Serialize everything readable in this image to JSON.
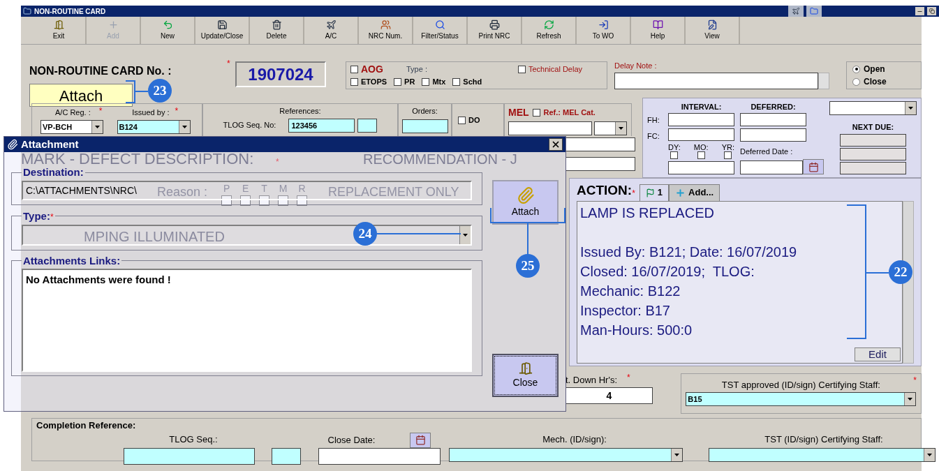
{
  "window": {
    "title": "NON-ROUTINE CARD"
  },
  "toolbar": [
    {
      "label": "Exit",
      "disabled": false
    },
    {
      "label": "Add",
      "disabled": true
    },
    {
      "label": "New",
      "disabled": false
    },
    {
      "label": "Update/Close",
      "disabled": false
    },
    {
      "label": "Delete",
      "disabled": false
    },
    {
      "label": "A/C",
      "disabled": false
    },
    {
      "label": "NRC Num.",
      "disabled": false
    },
    {
      "label": "Filter/Status",
      "disabled": false
    },
    {
      "label": "Print NRC",
      "disabled": false
    },
    {
      "label": "Refresh",
      "disabled": false
    },
    {
      "label": "To WO",
      "disabled": false
    },
    {
      "label": "Help",
      "disabled": false
    },
    {
      "label": "View",
      "disabled": false
    }
  ],
  "card_number": {
    "label": "NON-ROUTINE CARD No. :",
    "required_mark": "*",
    "value": "1907024"
  },
  "attach_shortcut": {
    "label": "Attach"
  },
  "flags": {
    "type_label": "Type :",
    "items": [
      {
        "label": "AOG",
        "checked": false,
        "kind": "alert"
      },
      {
        "label": "ETOPS",
        "checked": false,
        "kind": "plain"
      },
      {
        "label": "PR",
        "checked": false,
        "kind": "plain"
      },
      {
        "label": "Mtx",
        "checked": false,
        "kind": "plain"
      },
      {
        "label": "Schd",
        "checked": false,
        "kind": "plain"
      }
    ],
    "technical_delay": {
      "label": "Technical Delay",
      "checked": false
    }
  },
  "delay_note": {
    "label": "Delay Note :"
  },
  "status": [
    {
      "label": "Open",
      "selected": true
    },
    {
      "label": "Close",
      "selected": false
    }
  ],
  "aircraft": {
    "reg_label": "A/C Reg. :",
    "reg_required_mark": "*",
    "reg_value": "VP-BCH",
    "issued_label": "Issued by :",
    "issued_required_mark": "*",
    "issued_value": "B124"
  },
  "references": {
    "title": "References:",
    "tlog_label": "TLOG Seq. No:",
    "tlog_value": "123456"
  },
  "orders": {
    "title": "Orders:"
  },
  "do": {
    "label": "DO",
    "checked": false
  },
  "mel": {
    "title": "MEL",
    "ref_label": "Ref.: MEL Cat.",
    "ref_checked": false
  },
  "interval": {
    "interval_title": "INTERVAL:",
    "deferred_title": "DEFERRED:",
    "fh_label": "FH:",
    "fc_label": "FC:",
    "period_checks": [
      {
        "label": "DY:",
        "checked": false
      },
      {
        "label": "MO:",
        "checked": false
      },
      {
        "label": "YR:",
        "checked": false
      }
    ],
    "deferred_date_label": "Deferred Date :",
    "next_due_title": "NEXT DUE:"
  },
  "background_form": {
    "defect_title": "MARK - DEFECT DESCRIPTION:",
    "defect_required_mark": "*",
    "recommendation_title": "RECOMMENDATION - J",
    "reason_label": "Reason :",
    "reason_checks": [
      {
        "label": "P",
        "checked": false
      },
      {
        "label": "E",
        "checked": false
      },
      {
        "label": "T",
        "checked": false
      },
      {
        "label": "M",
        "checked": false
      },
      {
        "label": "R",
        "checked": false
      }
    ],
    "defect_text": "MPING ILLUMINATED",
    "recommendation_text": "REPLACEMENT ONLY"
  },
  "action": {
    "title": "ACTION:",
    "required_mark": "*",
    "tabs": [
      {
        "label": "1",
        "selected": true
      },
      {
        "label": "Add...",
        "selected": false
      }
    ],
    "paragraphs": [
      [
        "LAMP IS REPLACED"
      ],
      [
        "Issued By: B121; Date: 16/07/2019",
        "Closed: 16/07/2019;  TLOG:",
        "Mechanic: B122",
        "Inspector: B17",
        "Man-Hours: 500:0"
      ]
    ],
    "edit_button": "Edit"
  },
  "down_hours": {
    "label": "t. Down Hr's:",
    "required_mark": "*",
    "value": "4"
  },
  "tst_approved": {
    "label": "TST approved (ID/sign) Certifying Staff:",
    "required_mark": "*",
    "value": "B15"
  },
  "completion": {
    "title": "Completion Reference:",
    "tlog_label": "TLOG Seq.:",
    "close_date_label": "Close Date:",
    "mech_label": "Mech. (ID/sign):",
    "tst_label": "TST (ID/sign) Certifying Staff:"
  },
  "attachment_dialog": {
    "title": "Attachment",
    "destination_label": "Destination:",
    "destination_value": "C:\\ATTACHMENTS\\NRC\\",
    "type_label": "Type:",
    "type_required_mark": "*",
    "links_label": "Attachments Links:",
    "links_message": "No Attachments were found !",
    "attach_button": "Attach",
    "close_button": "Close"
  },
  "callouts": [
    {
      "number": "23"
    },
    {
      "number": "24"
    },
    {
      "number": "25"
    },
    {
      "number": "22"
    }
  ]
}
